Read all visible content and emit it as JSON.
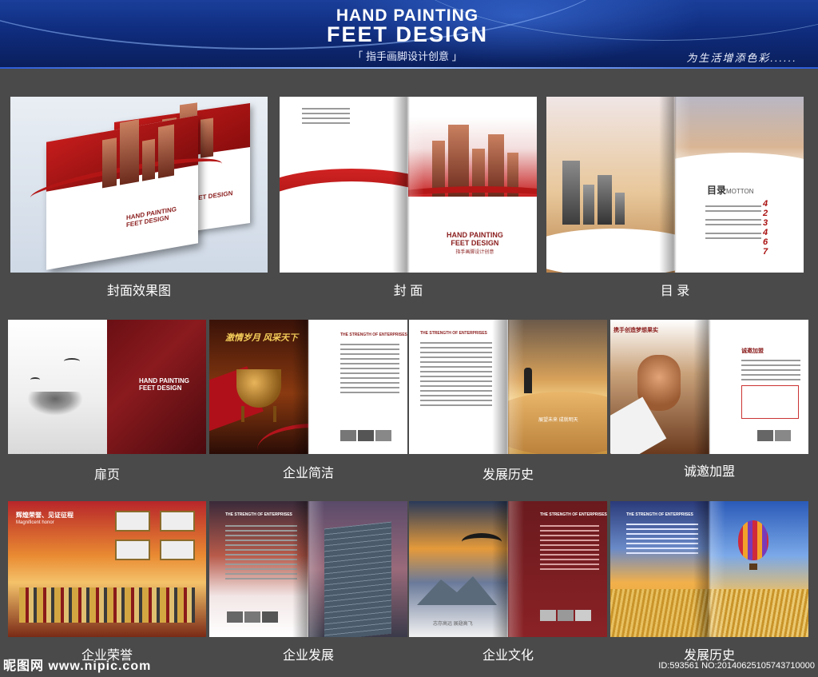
{
  "header": {
    "title_line1": "HAND PAINTING",
    "title_line2": "FEET DESIGN",
    "subtitle": "「 指手画脚设计创意 」",
    "tagline": "为生活增添色彩......"
  },
  "mock": {
    "brand_line1": "HAND PAINTING",
    "brand_line2": "FEET DESIGN",
    "brand_sub": "指手画脚设计创意",
    "toc_heading": "目录",
    "toc_sub": "MOTTON",
    "toc_numbers": [
      "4",
      "2",
      "3",
      "4",
      "6",
      "7"
    ],
    "hero_slogan": "激情岁月 风采天下",
    "section_heading_en": "THE STRENGTH OF ENTERPRISES",
    "cooperation_heading": "携手创造梦想果实",
    "join_heading": "诚邀加盟",
    "honor_heading": "辉煌荣誉、见证征程",
    "honor_sub": "Magnificent honor",
    "desert_caption": "展望未来 成就明天",
    "eagle_caption": "志存高远 展翅高飞"
  },
  "captions": [
    "封面效果图",
    "封 面",
    "目 录",
    "扉页",
    "企业简洁",
    "发展历史",
    "诚邀加盟",
    "企业荣誉",
    "企业发展",
    "企业文化",
    "发展历史"
  ],
  "watermark": {
    "left": "昵图网 www.nipic.com",
    "right": "ID:593561 NO:20140625105743710000"
  }
}
